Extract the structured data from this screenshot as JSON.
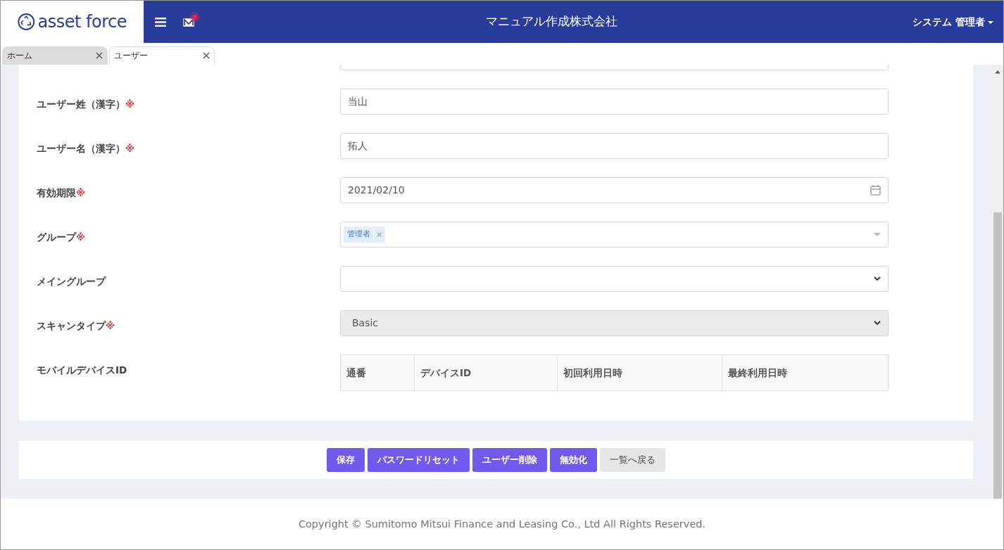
{
  "header": {
    "logo_text": "asset force",
    "company": "マニュアル作成株式会社",
    "user_menu": "システム 管理者",
    "mail_unread": true
  },
  "tabs": [
    {
      "label": "ホーム",
      "selected": false
    },
    {
      "label": "ユーザー",
      "selected": true
    }
  ],
  "form": [
    {
      "kind": "text",
      "label": "ユーザー姓（漢字）",
      "required": true,
      "value": "当山"
    },
    {
      "kind": "text",
      "label": "ユーザー名（漢字）",
      "required": true,
      "value": "拓人"
    },
    {
      "kind": "date",
      "label": "有効期限",
      "required": true,
      "value": "2021/02/10"
    },
    {
      "kind": "tags",
      "label": "グループ",
      "required": true,
      "tags": [
        "管理者"
      ]
    },
    {
      "kind": "select",
      "label": "メイングループ",
      "required": false,
      "disabled": false
    },
    {
      "kind": "select",
      "label": "スキャンタイプ",
      "required": true,
      "value": "Basic",
      "disabled": true
    },
    {
      "kind": "table",
      "label": "モバイルデバイスID",
      "required": false,
      "columns": [
        "通番",
        "デバイスID",
        "初回利用日時",
        "最終利用日時"
      ]
    }
  ],
  "required_mark": "※",
  "buttons": [
    {
      "label": "保存",
      "kind": "primary"
    },
    {
      "label": "パスワードリセット",
      "kind": "primary"
    },
    {
      "label": "ユーザー削除",
      "kind": "primary"
    },
    {
      "label": "無効化",
      "kind": "primary"
    },
    {
      "label": "一覧へ戻る",
      "kind": "secondary"
    }
  ],
  "footer": "Copyright © Sumitomo Mitsui Finance and Leasing Co., Ltd All Rights Reserved."
}
